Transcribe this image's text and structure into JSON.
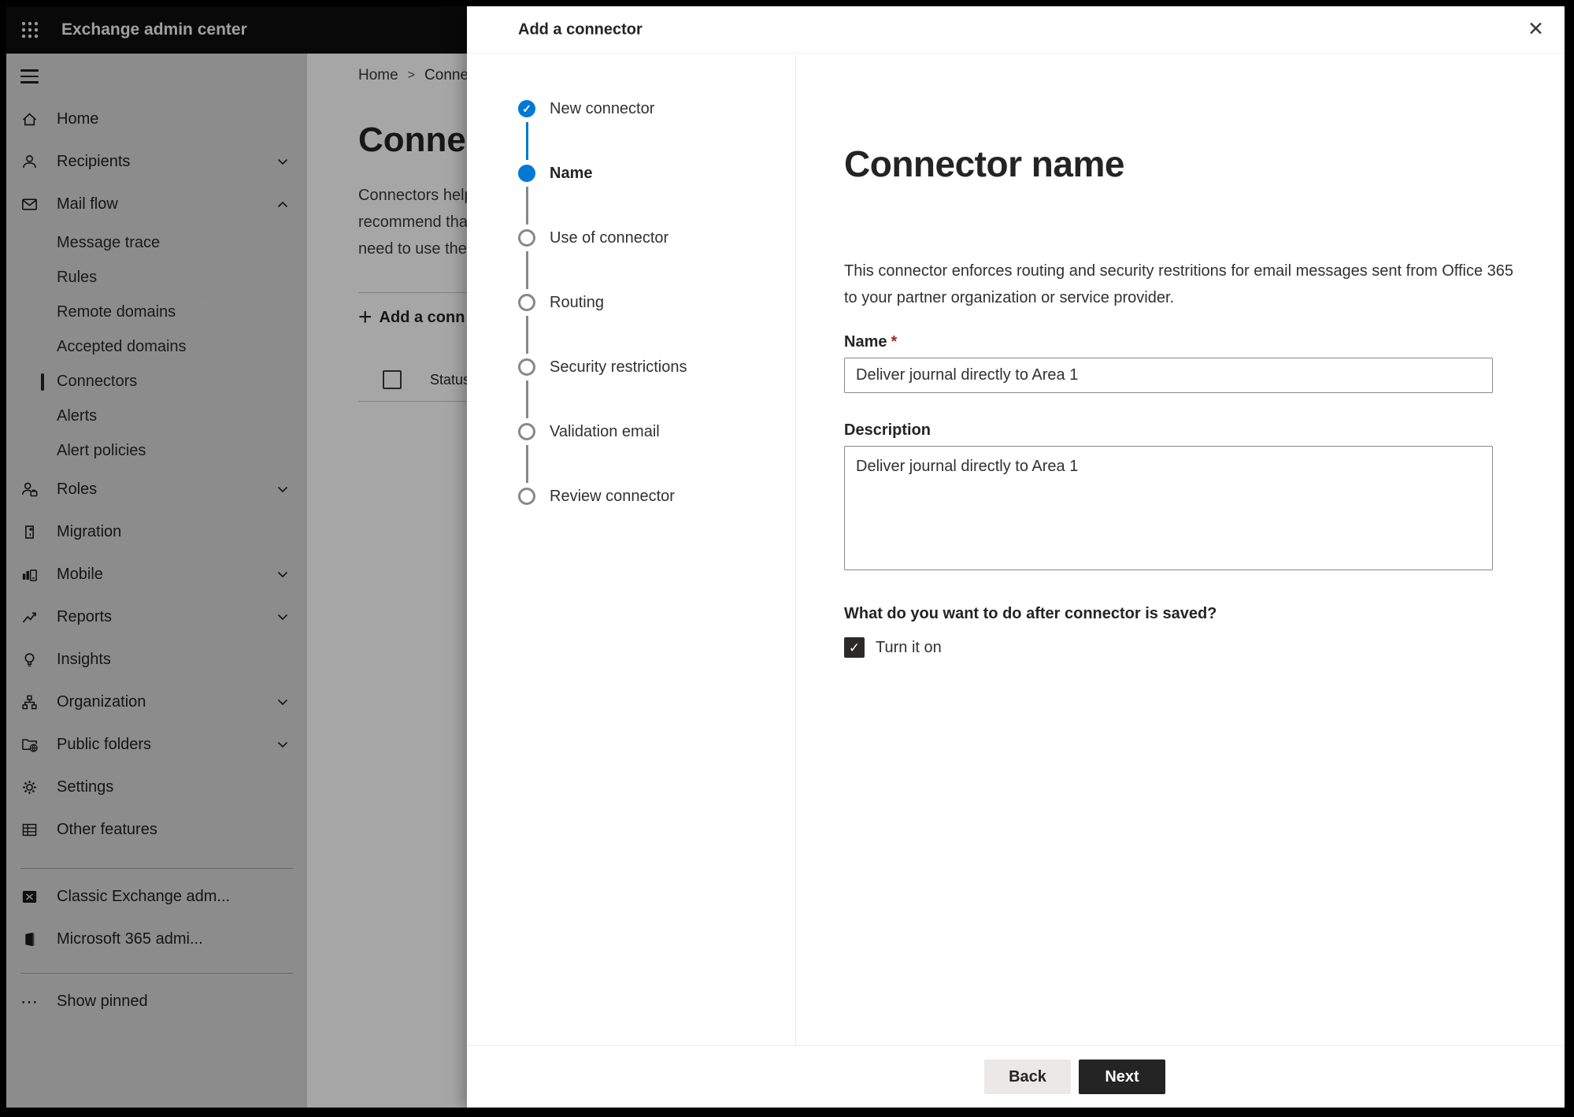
{
  "topbar": {
    "title": "Exchange admin center"
  },
  "sidebar": {
    "items": [
      {
        "label": "Home",
        "icon": "home-icon",
        "type": "main"
      },
      {
        "label": "Recipients",
        "icon": "person-icon",
        "type": "main",
        "chevron": "down"
      },
      {
        "label": "Mail flow",
        "icon": "mail-icon",
        "type": "main",
        "chevron": "up"
      },
      {
        "label": "Message trace",
        "type": "sub"
      },
      {
        "label": "Rules",
        "type": "sub"
      },
      {
        "label": "Remote domains",
        "type": "sub"
      },
      {
        "label": "Accepted domains",
        "type": "sub"
      },
      {
        "label": "Connectors",
        "type": "sub",
        "selected": true
      },
      {
        "label": "Alerts",
        "type": "sub"
      },
      {
        "label": "Alert policies",
        "type": "sub"
      },
      {
        "label": "Roles",
        "icon": "roles-icon",
        "type": "main",
        "chevron": "down"
      },
      {
        "label": "Migration",
        "icon": "migration-icon",
        "type": "main"
      },
      {
        "label": "Mobile",
        "icon": "mobile-icon",
        "type": "main",
        "chevron": "down"
      },
      {
        "label": "Reports",
        "icon": "reports-icon",
        "type": "main",
        "chevron": "down"
      },
      {
        "label": "Insights",
        "icon": "insights-icon",
        "type": "main"
      },
      {
        "label": "Organization",
        "icon": "organization-icon",
        "type": "main",
        "chevron": "down"
      },
      {
        "label": "Public folders",
        "icon": "public-folders-icon",
        "type": "main",
        "chevron": "down"
      },
      {
        "label": "Settings",
        "icon": "gear-icon",
        "type": "main"
      },
      {
        "label": "Other features",
        "icon": "table-icon",
        "type": "main"
      },
      {
        "label": "Classic Exchange adm...",
        "icon": "exchange-logo-icon",
        "type": "main"
      },
      {
        "label": "Microsoft 365 admi...",
        "icon": "m365-logo-icon",
        "type": "main"
      },
      {
        "label": "Show pinned",
        "icon": "ellipsis-icon",
        "type": "main"
      }
    ]
  },
  "content": {
    "breadcrumb": {
      "home": "Home",
      "current": "Conne"
    },
    "title": "Connec",
    "paragraph_lines": [
      "Connectors help",
      "recommend that",
      "need to use ther"
    ],
    "add_button_label": "Add a conn",
    "table_header": "Status"
  },
  "panel": {
    "title": "Add a connector",
    "steps": [
      {
        "label": "New connector",
        "state": "completed"
      },
      {
        "label": "Name",
        "state": "current"
      },
      {
        "label": "Use of connector",
        "state": "todo"
      },
      {
        "label": "Routing",
        "state": "todo"
      },
      {
        "label": "Security restrictions",
        "state": "todo"
      },
      {
        "label": "Validation email",
        "state": "todo"
      },
      {
        "label": "Review connector",
        "state": "todo"
      }
    ],
    "heading": "Connector name",
    "description_line1": "This connector enforces routing and security restritions for email messages sent from Office 365",
    "description_line2": "to your partner organization or service provider.",
    "name_field": {
      "label": "Name",
      "required_mark": "*",
      "value": "Deliver journal directly to Area 1"
    },
    "description_field": {
      "label": "Description",
      "value": "Deliver journal directly to Area 1"
    },
    "question": "What do you want to do after connector is saved?",
    "checkbox": {
      "label": "Turn it on",
      "checked": true
    },
    "back_label": "Back",
    "next_label": "Next"
  },
  "icons": {
    "close": "✕",
    "check": "✓",
    "plus": "+",
    "breadcrumb_separator": ">",
    "ellipsis": "⋯"
  },
  "colors": {
    "accent_blue": "#0078d4",
    "topbar_bg": "#0e0e0e",
    "next_button_bg": "#242424",
    "back_button_bg": "#ebe9e8",
    "required_red": "#a4262c",
    "scrim": "rgba(0,0,0,0.35)"
  }
}
